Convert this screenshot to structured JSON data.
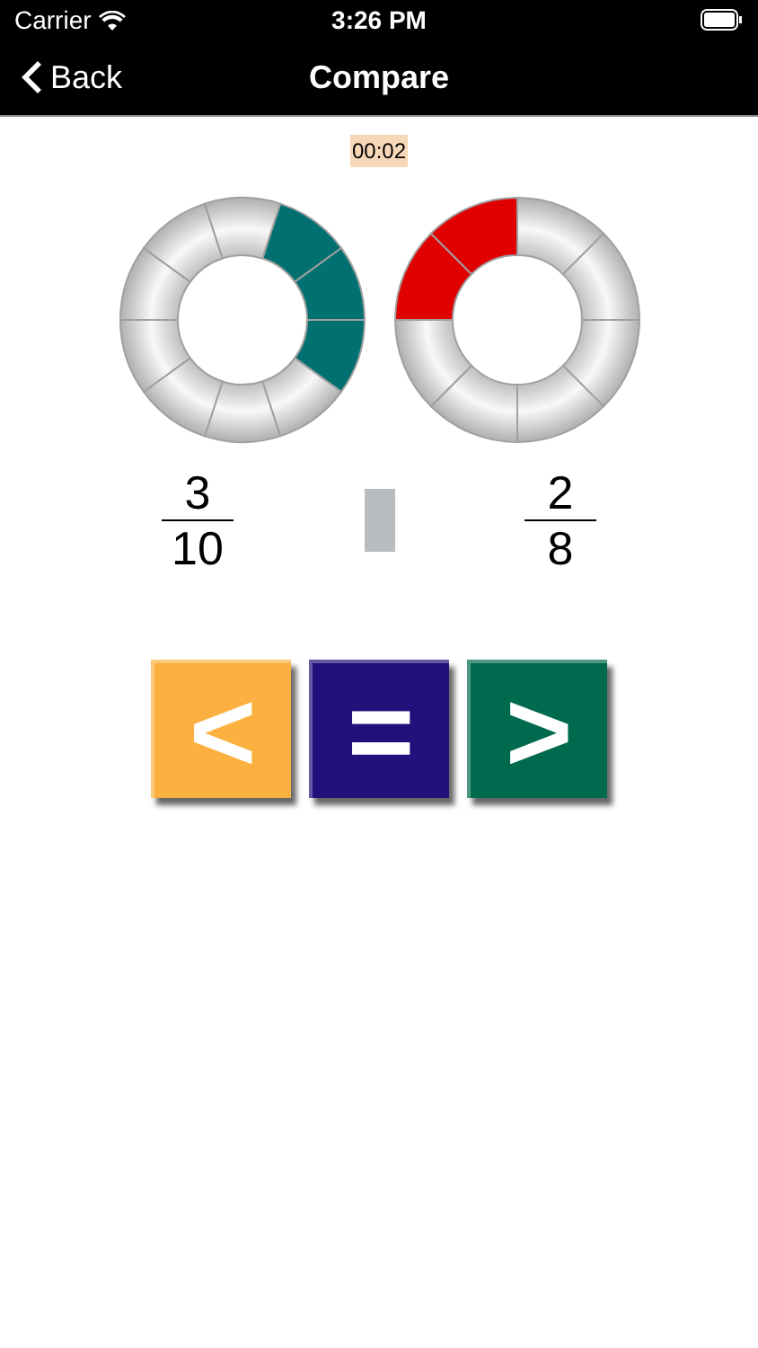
{
  "status_bar": {
    "carrier": "Carrier",
    "time": "3:26 PM"
  },
  "nav": {
    "back": "Back",
    "title": "Compare"
  },
  "timer": "00:02",
  "rings": [
    {
      "color": "#007070",
      "segments": [
        {
          "filled": true
        },
        {
          "filled": true
        },
        {
          "filled": true
        },
        {
          "filled": false
        },
        {
          "filled": false
        },
        {
          "filled": false
        },
        {
          "filled": false
        },
        {
          "filled": false
        },
        {
          "filled": false
        },
        {
          "filled": false
        }
      ]
    },
    {
      "color": "#e00000",
      "segments": [
        {
          "filled": false
        },
        {
          "filled": false
        },
        {
          "filled": false
        },
        {
          "filled": false
        },
        {
          "filled": false
        },
        {
          "filled": false
        },
        {
          "filled": true
        },
        {
          "filled": true
        }
      ]
    }
  ],
  "fractions": [
    {
      "numerator": "3",
      "denominator": "10"
    },
    {
      "numerator": "2",
      "denominator": "8"
    }
  ],
  "answer_slot": {
    "filled": false
  },
  "buttons": [
    {
      "symbol": "<",
      "color": "#fbb040"
    },
    {
      "symbol": "=",
      "color": "#22117a"
    },
    {
      "symbol": ">",
      "color": "#006a4e"
    }
  ]
}
